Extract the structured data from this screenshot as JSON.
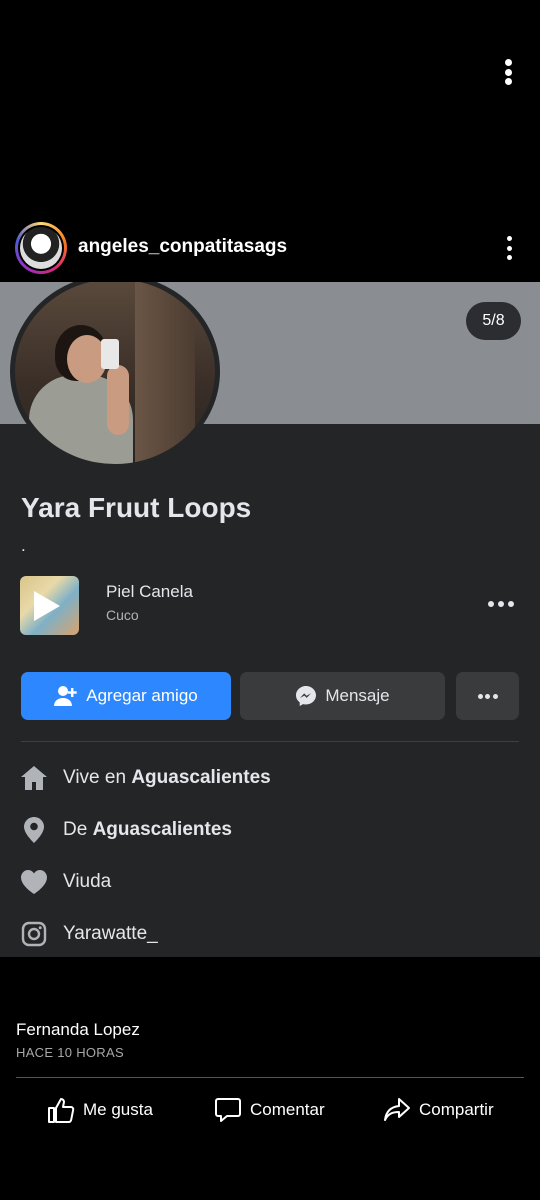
{
  "post": {
    "username": "angeles_conpatitasags",
    "image_counter": "5/8"
  },
  "profile": {
    "name": "Yara Fruut Loops",
    "bio": ".",
    "song": {
      "title": "Piel Canela",
      "artist": "Cuco"
    },
    "buttons": {
      "add_friend": "Agregar amigo",
      "message": "Mensaje"
    },
    "details": {
      "lives_prefix": "Vive en ",
      "lives_city": "Aguascalientes",
      "from_prefix": "De ",
      "from_city": "Aguascalientes",
      "relationship": "Viuda",
      "instagram": "Yarawatte_"
    }
  },
  "comment": {
    "author": "Fernanda Lopez",
    "time": "HACE 10 HORAS"
  },
  "actions": {
    "like": "Me gusta",
    "comment": "Comentar",
    "share": "Compartir"
  },
  "icons": {
    "top_more": "more-vertical-icon",
    "header_more": "more-vertical-icon",
    "play": "play-icon",
    "add_friend": "add-person-icon",
    "message": "messenger-icon",
    "home": "home-icon",
    "location": "location-pin-icon",
    "heart": "heart-icon",
    "instagram": "instagram-icon",
    "like": "thumbs-up-icon",
    "comment": "speech-bubble-icon",
    "share": "share-arrow-icon"
  },
  "colors": {
    "primary_button": "#2d88ff",
    "secondary_button": "#3a3b3c",
    "card_bg": "#242526",
    "cover_bg": "#8a8d91"
  }
}
